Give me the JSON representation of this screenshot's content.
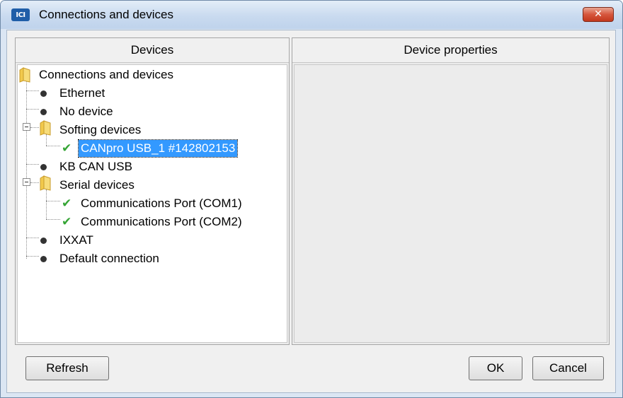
{
  "window": {
    "title": "Connections and devices",
    "app_icon_text": "ICI",
    "close_glyph": "✕",
    "close_icon": "close-icon"
  },
  "devices_panel": {
    "header": "Devices",
    "tree": [
      {
        "label": "Connections and devices",
        "icon": "folder-icon",
        "level": 0
      },
      {
        "label": "Ethernet",
        "icon": "bullet-icon",
        "level": 1
      },
      {
        "label": "No device",
        "icon": "bullet-icon",
        "level": 1
      },
      {
        "label": "Softing devices",
        "icon": "folder-icon",
        "level": 1,
        "expanded": true
      },
      {
        "label": "CANpro USB_1 #142802153",
        "icon": "check-icon",
        "level": 2,
        "selected": true
      },
      {
        "label": "KB CAN USB",
        "icon": "bullet-icon",
        "level": 1
      },
      {
        "label": "Serial devices",
        "icon": "folder-icon",
        "level": 1,
        "expanded": true
      },
      {
        "label": "Communications Port (COM1)",
        "icon": "check-icon",
        "level": 2
      },
      {
        "label": "Communications Port (COM2)",
        "icon": "check-icon",
        "level": 2
      },
      {
        "label": "IXXAT",
        "icon": "bullet-icon",
        "level": 1
      },
      {
        "label": "Default connection",
        "icon": "bullet-icon",
        "level": 1
      }
    ]
  },
  "properties_panel": {
    "header": "Device properties"
  },
  "buttons": {
    "refresh": "Refresh",
    "ok": "OK",
    "cancel": "Cancel"
  },
  "colors": {
    "selection": "#3399ff",
    "check": "#35a535",
    "close": "#c94a2f",
    "folder": "#f2c94c"
  }
}
